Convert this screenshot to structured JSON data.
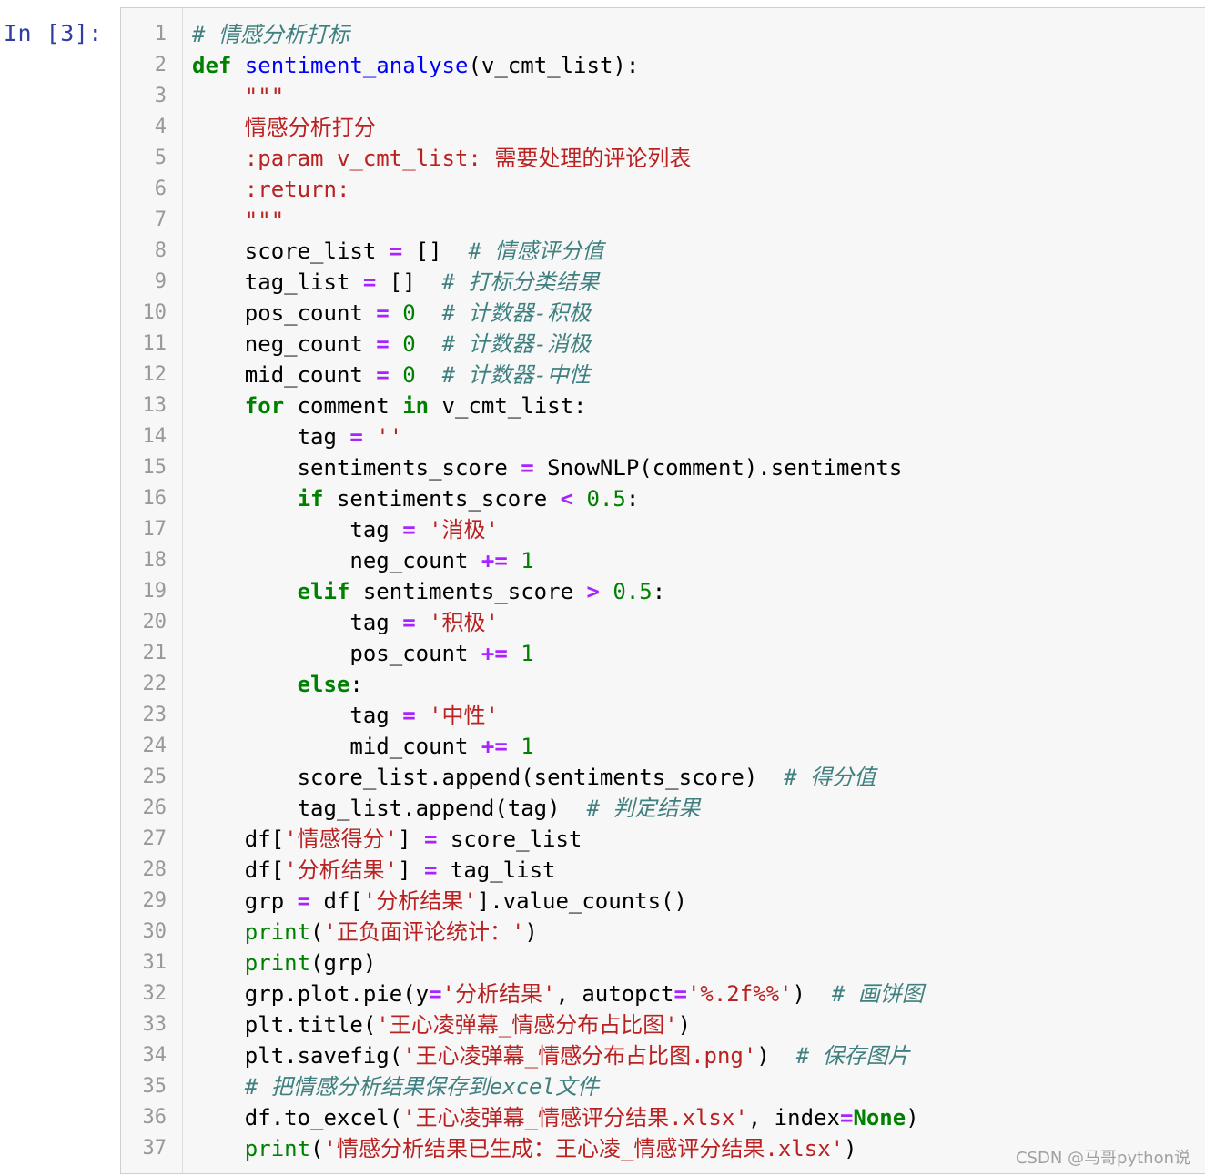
{
  "prompt": "In [3]:",
  "watermark": "CSDN @马哥python说",
  "lines": [
    [
      [
        "cm",
        "# 情感分析打标"
      ]
    ],
    [
      [
        "kw",
        "def"
      ],
      [
        "",
        " "
      ],
      [
        "def",
        "sentiment_analyse"
      ],
      [
        "",
        "(v_cmt_list):"
      ]
    ],
    [
      [
        "",
        "    "
      ],
      [
        "str",
        "\"\"\""
      ]
    ],
    [
      [
        "",
        "    "
      ],
      [
        "str",
        "情感分析打分"
      ]
    ],
    [
      [
        "",
        "    "
      ],
      [
        "str",
        ":param v_cmt_list: 需要处理的评论列表"
      ]
    ],
    [
      [
        "",
        "    "
      ],
      [
        "str",
        ":return:"
      ]
    ],
    [
      [
        "",
        "    "
      ],
      [
        "str",
        "\"\"\""
      ]
    ],
    [
      [
        "",
        "    score_list "
      ],
      [
        "op",
        "="
      ],
      [
        "",
        " []  "
      ],
      [
        "cm",
        "# 情感评分值"
      ]
    ],
    [
      [
        "",
        "    tag_list "
      ],
      [
        "op",
        "="
      ],
      [
        "",
        " []  "
      ],
      [
        "cm",
        "# 打标分类结果"
      ]
    ],
    [
      [
        "",
        "    pos_count "
      ],
      [
        "op",
        "="
      ],
      [
        "",
        " "
      ],
      [
        "num",
        "0"
      ],
      [
        "",
        "  "
      ],
      [
        "cm",
        "# 计数器-积极"
      ]
    ],
    [
      [
        "",
        "    neg_count "
      ],
      [
        "op",
        "="
      ],
      [
        "",
        " "
      ],
      [
        "num",
        "0"
      ],
      [
        "",
        "  "
      ],
      [
        "cm",
        "# 计数器-消极"
      ]
    ],
    [
      [
        "",
        "    mid_count "
      ],
      [
        "op",
        "="
      ],
      [
        "",
        " "
      ],
      [
        "num",
        "0"
      ],
      [
        "",
        "  "
      ],
      [
        "cm",
        "# 计数器-中性"
      ]
    ],
    [
      [
        "",
        "    "
      ],
      [
        "kw",
        "for"
      ],
      [
        "",
        " comment "
      ],
      [
        "kw",
        "in"
      ],
      [
        "",
        " v_cmt_list:"
      ]
    ],
    [
      [
        "",
        "        tag "
      ],
      [
        "op",
        "="
      ],
      [
        "",
        " "
      ],
      [
        "str",
        "''"
      ]
    ],
    [
      [
        "",
        "        sentiments_score "
      ],
      [
        "op",
        "="
      ],
      [
        "",
        " SnowNLP(comment).sentiments"
      ]
    ],
    [
      [
        "",
        "        "
      ],
      [
        "kw",
        "if"
      ],
      [
        "",
        " sentiments_score "
      ],
      [
        "op",
        "<"
      ],
      [
        "",
        " "
      ],
      [
        "num",
        "0.5"
      ],
      [
        "",
        ":"
      ]
    ],
    [
      [
        "",
        "            tag "
      ],
      [
        "op",
        "="
      ],
      [
        "",
        " "
      ],
      [
        "str",
        "'消极'"
      ]
    ],
    [
      [
        "",
        "            neg_count "
      ],
      [
        "op",
        "+="
      ],
      [
        "",
        " "
      ],
      [
        "num",
        "1"
      ]
    ],
    [
      [
        "",
        "        "
      ],
      [
        "kw",
        "elif"
      ],
      [
        "",
        " sentiments_score "
      ],
      [
        "op",
        ">"
      ],
      [
        "",
        " "
      ],
      [
        "num",
        "0.5"
      ],
      [
        "",
        ":"
      ]
    ],
    [
      [
        "",
        "            tag "
      ],
      [
        "op",
        "="
      ],
      [
        "",
        " "
      ],
      [
        "str",
        "'积极'"
      ]
    ],
    [
      [
        "",
        "            pos_count "
      ],
      [
        "op",
        "+="
      ],
      [
        "",
        " "
      ],
      [
        "num",
        "1"
      ]
    ],
    [
      [
        "",
        "        "
      ],
      [
        "kw",
        "else"
      ],
      [
        "",
        ":"
      ]
    ],
    [
      [
        "",
        "            tag "
      ],
      [
        "op",
        "="
      ],
      [
        "",
        " "
      ],
      [
        "str",
        "'中性'"
      ]
    ],
    [
      [
        "",
        "            mid_count "
      ],
      [
        "op",
        "+="
      ],
      [
        "",
        " "
      ],
      [
        "num",
        "1"
      ]
    ],
    [
      [
        "",
        "        score_list.append(sentiments_score)  "
      ],
      [
        "cm",
        "# 得分值"
      ]
    ],
    [
      [
        "",
        "        tag_list.append(tag)  "
      ],
      [
        "cm",
        "# 判定结果"
      ]
    ],
    [
      [
        "",
        "    df["
      ],
      [
        "str",
        "'情感得分'"
      ],
      [
        "",
        "] "
      ],
      [
        "op",
        "="
      ],
      [
        "",
        " score_list"
      ]
    ],
    [
      [
        "",
        "    df["
      ],
      [
        "str",
        "'分析结果'"
      ],
      [
        "",
        "] "
      ],
      [
        "op",
        "="
      ],
      [
        "",
        " tag_list"
      ]
    ],
    [
      [
        "",
        "    grp "
      ],
      [
        "op",
        "="
      ],
      [
        "",
        " df["
      ],
      [
        "str",
        "'分析结果'"
      ],
      [
        "",
        "].value_counts()"
      ]
    ],
    [
      [
        "",
        "    "
      ],
      [
        "bi",
        "print"
      ],
      [
        "",
        "("
      ],
      [
        "str",
        "'正负面评论统计：'"
      ],
      [
        "",
        ")"
      ]
    ],
    [
      [
        "",
        "    "
      ],
      [
        "bi",
        "print"
      ],
      [
        "",
        "(grp)"
      ]
    ],
    [
      [
        "",
        "    grp.plot.pie(y"
      ],
      [
        "op",
        "="
      ],
      [
        "str",
        "'分析结果'"
      ],
      [
        "",
        ", autopct"
      ],
      [
        "op",
        "="
      ],
      [
        "str",
        "'%.2f%%'"
      ],
      [
        "",
        ")  "
      ],
      [
        "cm",
        "# 画饼图"
      ]
    ],
    [
      [
        "",
        "    plt.title("
      ],
      [
        "str",
        "'王心凌弹幕_情感分布占比图'"
      ],
      [
        "",
        ")"
      ]
    ],
    [
      [
        "",
        "    plt.savefig("
      ],
      [
        "str",
        "'王心凌弹幕_情感分布占比图.png'"
      ],
      [
        "",
        ")  "
      ],
      [
        "cm",
        "# 保存图片"
      ]
    ],
    [
      [
        "",
        "    "
      ],
      [
        "cm",
        "# 把情感分析结果保存到excel文件"
      ]
    ],
    [
      [
        "",
        "    df.to_excel("
      ],
      [
        "str",
        "'王心凌弹幕_情感评分结果.xlsx'"
      ],
      [
        "",
        ", index"
      ],
      [
        "op",
        "="
      ],
      [
        "kw",
        "None"
      ],
      [
        "",
        ")"
      ]
    ],
    [
      [
        "",
        "    "
      ],
      [
        "bi",
        "print"
      ],
      [
        "",
        "("
      ],
      [
        "str",
        "'情感分析结果已生成：王心凌_情感评分结果.xlsx'"
      ],
      [
        "",
        ")"
      ]
    ]
  ]
}
